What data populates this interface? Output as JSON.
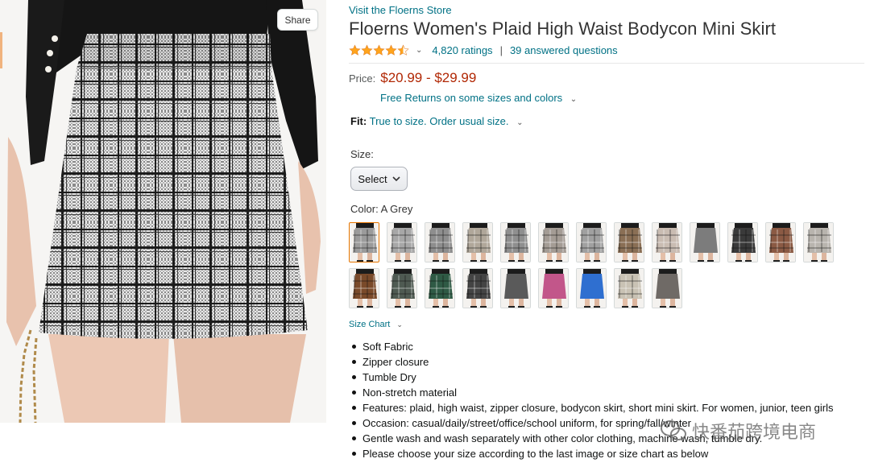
{
  "product_image": {
    "share_label": "Share"
  },
  "product": {
    "store_link": "Visit the Floerns Store",
    "title": "Floerns Women's Plaid High Waist Bodycon Mini Skirt",
    "rating_stars": 4.3,
    "ratings_count": "4,820 ratings",
    "separator": "|",
    "answered_questions": "39 answered questions",
    "price_label": "Price:",
    "price": "$20.99 - $29.99",
    "free_returns": "Free Returns on some sizes and colors",
    "fit_label": "Fit:",
    "fit_value": "True to size. Order usual size.",
    "size_label": "Size:",
    "size_select": "Select",
    "color_label": "Color:",
    "color_value": "A Grey",
    "size_chart": "Size Chart",
    "bullets": [
      "Soft Fabric",
      "Zipper closure",
      "Tumble Dry",
      "Non-stretch material",
      "Features: plaid, high waist, zipper closure, bodycon skirt, short mini skirt. For women, junior, teen girls",
      "Occasion: casual/daily/street/office/school uniform, for spring/fall/winter",
      "Gentle wash and wash separately with other color clothing, machine wash, tumble dry.",
      "Please choose your size according to the last image or size chart as below"
    ]
  },
  "swatches": [
    {
      "color": "#9b9b9b",
      "plaid": true,
      "selected": true
    },
    {
      "color": "#a7a7a7",
      "plaid": true
    },
    {
      "color": "#8e8e8e",
      "plaid": true
    },
    {
      "color": "#b0a79a",
      "plaid": true
    },
    {
      "color": "#8f8f8f",
      "plaid": true
    },
    {
      "color": "#a49c95",
      "plaid": true
    },
    {
      "color": "#a0a0a0",
      "plaid": true
    },
    {
      "color": "#8a6f55",
      "plaid": true
    },
    {
      "color": "#c9bcb2",
      "plaid": true
    },
    {
      "color": "#7c7c7c",
      "plaid": false
    },
    {
      "color": "#3a3a3a",
      "plaid": true
    },
    {
      "color": "#8b5a44",
      "plaid": true
    },
    {
      "color": "#b8b4ae",
      "plaid": true
    },
    {
      "color": "#7a4a2a",
      "plaid": true
    },
    {
      "color": "#4f5a52",
      "plaid": true
    },
    {
      "color": "#2f5a45",
      "plaid": true
    },
    {
      "color": "#444444",
      "plaid": true
    },
    {
      "color": "#5a5a5a",
      "plaid": false
    },
    {
      "color": "#c2568a",
      "plaid": false
    },
    {
      "color": "#2f6fd0",
      "plaid": false
    },
    {
      "color": "#c9c2b4",
      "plaid": true
    },
    {
      "color": "#6f6a66",
      "plaid": false
    }
  ],
  "watermark": {
    "text": "快番茄跨境电商"
  },
  "colors": {
    "link": "#007185",
    "price": "#b12704",
    "star": "#ffa41c",
    "selected": "#e77600"
  }
}
